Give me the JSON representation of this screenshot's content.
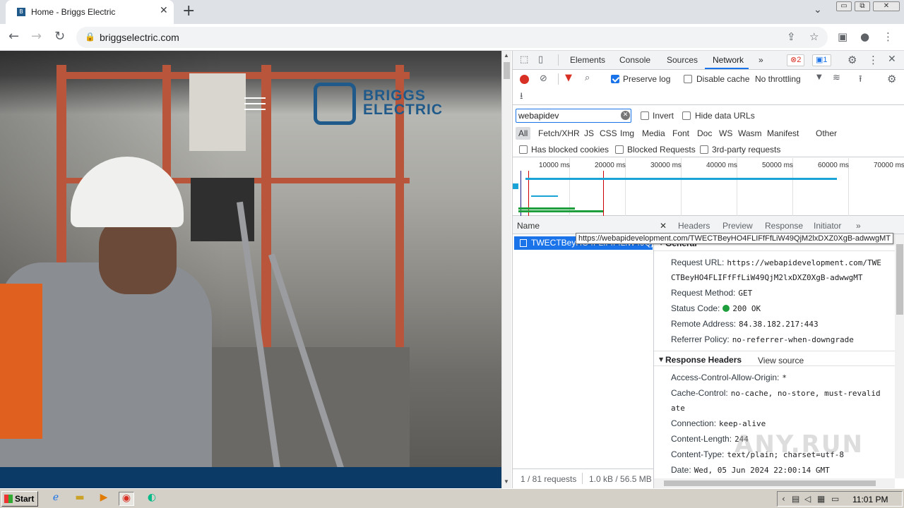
{
  "browser": {
    "tab_title": "Home - Briggs Electric",
    "tab_favicon": "B",
    "close_glyph": "✕",
    "newtab_glyph": "+",
    "tabsearch_glyph": "⌄",
    "url": "briggselectric.com",
    "icons": {
      "back": "arrow-left-icon",
      "forward": "arrow-right-icon",
      "reload": "reload-icon",
      "lock": "lock-icon",
      "share": "share-icon",
      "star": "star-icon",
      "sidepanel": "side-panel-icon",
      "profile": "profile-icon",
      "menu": "kebab-menu-icon"
    },
    "glyphs": {
      "back": "←",
      "forward": "→",
      "reload": "↻",
      "lock": "🔒",
      "share": "⇪",
      "star": "☆",
      "sidepanel": "▣",
      "profile": "●",
      "menu": "⋮"
    },
    "window_buttons": {
      "minimize": "▭",
      "restore": "⧉",
      "close": "✕"
    }
  },
  "site": {
    "logo_text_line1": "BRIGGS",
    "logo_text_line2": "ELECTRIC",
    "brand_color": "#1f5a8a",
    "footer_color": "#0b3a66"
  },
  "devtools": {
    "tabs": [
      "Elements",
      "Console",
      "Sources",
      "Network"
    ],
    "active_tab": "Network",
    "more_tabs_glyph": "»",
    "errors_count": "2",
    "messages_count": "1",
    "toolbar": {
      "preserve_log": "Preserve log",
      "preserve_log_checked": true,
      "disable_cache": "Disable cache",
      "disable_cache_checked": false,
      "throttling": "No throttling"
    },
    "filter": {
      "value": "webapidev",
      "invert": "Invert",
      "hide_data_urls": "Hide data URLs",
      "types": [
        "All",
        "Fetch/XHR",
        "JS",
        "CSS",
        "Img",
        "Media",
        "Font",
        "Doc",
        "WS",
        "Wasm",
        "Manifest",
        "Other"
      ],
      "active_type": "All",
      "has_blocked_cookies": "Has blocked cookies",
      "blocked_requests": "Blocked Requests",
      "third_party": "3rd-party requests"
    },
    "overview": {
      "ticks": [
        "10000 ms",
        "20000 ms",
        "30000 ms",
        "40000 ms",
        "50000 ms",
        "60000 ms",
        "70000 ms"
      ]
    },
    "requests": {
      "column_name": "Name",
      "selected_row": "TWECTBeyHO4FLIFfFfLiW49Qj",
      "summary_requests": "1 / 81 requests",
      "summary_size": "1.0 kB / 56.5 MB"
    },
    "tooltip": "https://webapidevelopment.com/TWECTBeyHO4FLIFfFfLiW49QjM2lxDXZ0XgB-adwwgMT",
    "detail_tabs": [
      "Headers",
      "Preview",
      "Response",
      "Initiator"
    ],
    "general": {
      "heading": "General",
      "request_url_label": "Request URL:",
      "request_url_line1": "https://webapidevelopment.com/TWE",
      "request_url_line2": "CTBeyHO4FLIFfFfLiW49QjM2lxDXZ0XgB-adwwgMT",
      "request_method_label": "Request Method:",
      "request_method": "GET",
      "status_code_label": "Status Code:",
      "status_code": "200 OK",
      "remote_address_label": "Remote Address:",
      "remote_address": "84.38.182.217:443",
      "referrer_policy_label": "Referrer Policy:",
      "referrer_policy": "no-referrer-when-downgrade"
    },
    "response_headers": {
      "heading": "Response Headers",
      "view_source": "View source",
      "acao_label": "Access-Control-Allow-Origin:",
      "acao": "*",
      "cache_control_label": "Cache-Control:",
      "cache_control_line1": "no-cache, no-store, must-revalid",
      "cache_control_line2": "ate",
      "connection_label": "Connection:",
      "connection": "keep-alive",
      "content_length_label": "Content-Length:",
      "content_length": "244",
      "content_type_label": "Content-Type:",
      "content_type": "text/plain; charset=utf-8",
      "date_label": "Date:",
      "date": "Wed, 05 Jun 2024 22:00:14 GMT"
    }
  },
  "taskbar": {
    "start_label": "Start",
    "clock": "11:01 PM",
    "icons": [
      "ie-icon",
      "folder-icon",
      "media-player-icon",
      "chrome-icon",
      "edge-icon"
    ]
  },
  "watermark": "ANY.RUN"
}
